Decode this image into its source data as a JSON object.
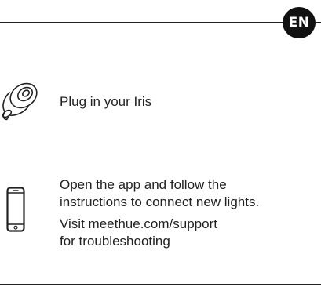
{
  "header": {
    "language_badge": "EN"
  },
  "steps": [
    {
      "icon": "lamp-icon",
      "text": "Plug in your Iris"
    },
    {
      "icon": "smartphone-icon",
      "lines": [
        "Open the app and follow the",
        "instructions to connect new lights."
      ],
      "support_lines": [
        "Visit meethue.com/support",
        "for troubleshooting"
      ]
    }
  ]
}
